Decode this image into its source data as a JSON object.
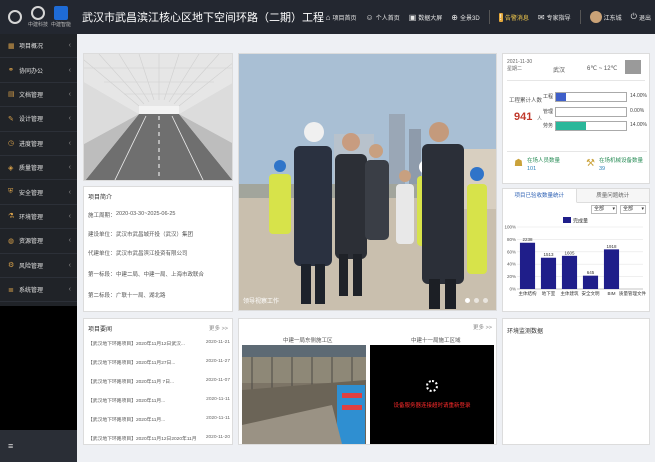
{
  "header": {
    "logos": [
      {
        "icon": "crest-logo-icon",
        "caption": ""
      },
      {
        "icon": "group-logo-icon",
        "caption": "中建科技"
      },
      {
        "icon": "brand-logo-icon",
        "caption": "中建智能"
      }
    ],
    "title": "武汉市武昌滨江核心区地下空间环路（二期）工程",
    "nav": [
      {
        "icon": "home-icon",
        "label": "项目首页"
      },
      {
        "icon": "user-icon",
        "label": "个人首页"
      },
      {
        "icon": "monitor-icon",
        "label": "数据大屏"
      },
      {
        "icon": "globe-icon",
        "label": "全景3D"
      }
    ],
    "warning": {
      "icon": "alert-icon",
      "label": "告警消息"
    },
    "logout_like": {
      "icon": "chat-icon",
      "label": "专家指导"
    },
    "user": {
      "name": "江东城"
    },
    "exit": {
      "icon": "power-icon",
      "label": "退出"
    }
  },
  "sidebar": {
    "items": [
      {
        "icon": "grid-icon",
        "label": "项目概况"
      },
      {
        "icon": "handshake-icon",
        "label": "协同办公"
      },
      {
        "icon": "folder-icon",
        "label": "文档管理"
      },
      {
        "icon": "design-icon",
        "label": "设计管理"
      },
      {
        "icon": "clock-icon",
        "label": "进度管理"
      },
      {
        "icon": "cube-icon",
        "label": "质量管理"
      },
      {
        "icon": "shield-icon",
        "label": "安全管理"
      },
      {
        "icon": "flask-icon",
        "label": "环境管理"
      },
      {
        "icon": "bag-icon",
        "label": "资源管理"
      },
      {
        "icon": "tool-icon",
        "label": "风险管理"
      },
      {
        "icon": "layers-icon",
        "label": "系统管理"
      }
    ],
    "toggle_icon": "menu-icon"
  },
  "intro": {
    "title": "项目简介",
    "rows": [
      {
        "k": "施工周期：",
        "v": "2020-03-30~2025-06-25"
      },
      {
        "k": "建设单位：",
        "v": "武汉市武昌城开投（武汉）集团"
      },
      {
        "k": "代建单位：",
        "v": "武汉市武昌滨江投资有限公司"
      },
      {
        "k": "第一标段：",
        "v": "中建二局、中建一局、上海市政联合"
      },
      {
        "k": "第二标段：",
        "v": "广联十一局、湖北路"
      }
    ]
  },
  "photo": {
    "caption": "领导视察工作"
  },
  "weather": {
    "date_line1": "2021-11-30",
    "date_line2": "星期二",
    "city": "武汉",
    "temperature": "6℃ ~ 12℃",
    "workers_label": "工程累计人数",
    "workers_total": "941",
    "workers_unit": "人",
    "bars": [
      {
        "label": "工程",
        "percent": 14.0,
        "pct_text": "14.00%",
        "color": "#3f5fc9"
      },
      {
        "label": "管理",
        "percent": 0.0,
        "pct_text": "0.00%",
        "color": "#3f5fc9"
      },
      {
        "label": "劳务",
        "percent": 43.0,
        "pct_text": "14.00%",
        "color": "#2bb79a"
      }
    ],
    "stats": [
      {
        "icon": "worker-icon",
        "label": "在场人员数量",
        "value": "101"
      },
      {
        "icon": "crane-icon",
        "label": "在场机械设备数量",
        "value": "39"
      }
    ]
  },
  "chart_tabs": [
    "项目已验收数量统计",
    "质量问题统计"
  ],
  "chart_selects": [
    "全部",
    "全部"
  ],
  "chart_data": {
    "type": "bar",
    "categories": [
      "主体结构",
      "地下室",
      "主体建筑",
      "安全文明",
      "BIM",
      "质量管理文件"
    ],
    "values": [
      2238,
      1513,
      1605,
      645,
      1918,
      0
    ],
    "value_labels": [
      "2238",
      "1513",
      "1605",
      "645",
      "1918",
      ""
    ],
    "legend": "完成量",
    "y_ticks": [
      "100%",
      "80%",
      "60%",
      "40%",
      "20%",
      "0%"
    ],
    "ylim": [
      0,
      3000
    ],
    "grid": true,
    "legend_position": "top",
    "color": "#1f1e8a"
  },
  "notices": {
    "title": "项目要闻",
    "more": "更多 >>",
    "items": [
      {
        "t": "【武汉地下环路项目】2020年11月12日武汉...",
        "d": "2020-11-21"
      },
      {
        "t": "【武汉地下环路项目】2020年11月27日...",
        "d": "2020-11-27"
      },
      {
        "t": "【武汉地下环路项目】2020年11月 7日...",
        "d": "2020-11-07"
      },
      {
        "t": "【武汉地下环路项目】2020年11月...",
        "d": "2020-11-11"
      },
      {
        "t": "【武汉地下环路项目】2020年11月...",
        "d": "2020-11-11"
      },
      {
        "t": "【武汉地下环路项目】2020年11月12日2020年11月",
        "d": "2020-11-20"
      }
    ]
  },
  "videos": {
    "more": "更多 >>",
    "cams": [
      {
        "label": "中建一局东侧施工区"
      },
      {
        "label": "中建十一局施工区域",
        "error": "设备服务器连接超时请重新登录"
      }
    ]
  },
  "env": {
    "title": "环境监测数据"
  }
}
